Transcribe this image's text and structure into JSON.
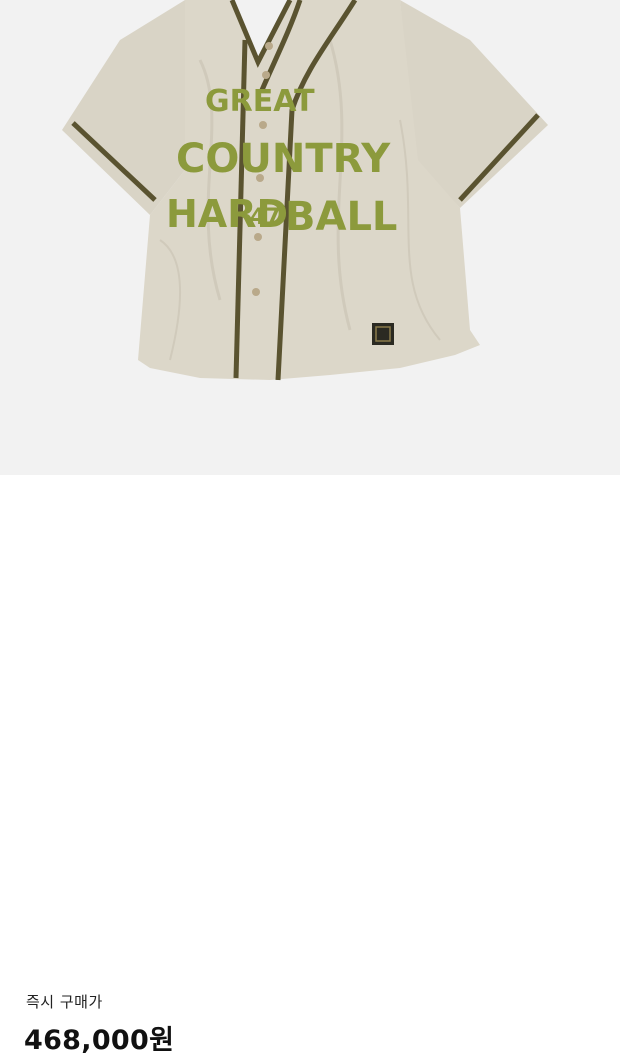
{
  "product": {
    "image_alt": "GREAT COUNTRY HARD BALL 47 baseball jersey",
    "jersey_text": {
      "line1": "GREAT",
      "line2": "COUNTRY",
      "line3_left": "HARD",
      "line3_number": "47",
      "line3_right": "BALL"
    }
  },
  "price_section": {
    "label": "즉시 구매가",
    "price": "468,000원"
  },
  "colors": {
    "image_background": "#f2f2f2",
    "shirt": "#d9d4c6",
    "piping": "#5a5330",
    "felt_letters": "#8c9a3c"
  }
}
